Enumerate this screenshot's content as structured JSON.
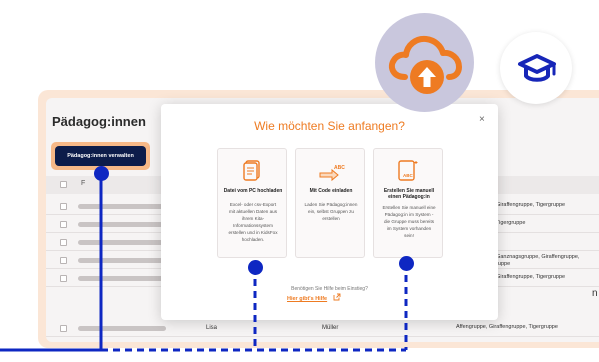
{
  "app": {
    "title": "Pädagog:innen",
    "manage_button": "Pädagog:innen verwalten",
    "header_first_col": "F",
    "side_letter": "n"
  },
  "rows": [
    {
      "first": "",
      "last": "",
      "groups": "Giraffengruppe, Tigergruppe",
      "groups_prefix": ",",
      "lines": 1
    },
    {
      "first": "",
      "last": "",
      "groups": "Tigergruppe",
      "groups_prefix": ",",
      "lines": 1
    },
    {
      "first": "",
      "last": "",
      "groups": "",
      "groups_prefix": "",
      "lines": 1
    },
    {
      "first": "",
      "last": "",
      "groups": "Ganznagsgruppe, Giraffengruppe,",
      "groups_line2": "gruppe",
      "groups_prefix": ",",
      "lines": 2
    },
    {
      "first": "",
      "last": "",
      "groups": "Giraffengruppe, Tigergruppe",
      "groups_prefix": ",",
      "lines": 1
    },
    {
      "first": "Lisa",
      "last": "Müller",
      "groups": "Affengruppe, Giraffengruppe, Tigergruppe",
      "groups_prefix": "",
      "lines": 1
    }
  ],
  "modal": {
    "title": "Wie möchten Sie anfangen?",
    "close_glyph": "×",
    "cards": [
      {
        "icon": "file-upload-icon",
        "title": "Datei vom PC hochladen",
        "text_lines": [
          "Excel- oder csv-Export",
          "mit aktuellen Daten aus",
          "ihrem Kita-",
          "Informationssystem",
          "erstellen und in KidsFox",
          "hochladen."
        ]
      },
      {
        "icon": "code-invite-icon",
        "badge": "ABC",
        "title": "Mit Code einladen",
        "text_lines": [
          "Laden Sie Pädagog:innen",
          "ein, selbst Gruppen zu",
          "erstellen"
        ]
      },
      {
        "icon": "manual-create-icon",
        "badge": "ABC",
        "title_lines": [
          "Erstellen Sie manuell",
          "einen Pädagog:in"
        ],
        "text_lines": [
          "Erstellen Sie manuell eine",
          "Pädagog:in im System -",
          "die Gruppe muss bereits",
          "im System vorhanden",
          "sein!"
        ]
      }
    ],
    "help_question": "Benötigen Sie Hilfe beim Einstieg?",
    "help_link": "Hier gibt's Hilfe"
  },
  "floating_icons": [
    "cloud-upload-icon",
    "graduation-cap-icon"
  ],
  "colors": {
    "accent_orange": "#ee7b22",
    "navy": "#0c1c4a",
    "callout_blue": "#0e27c2",
    "frame_peach": "#fbe6d6",
    "cloud_circle": "#c9c7dd",
    "status_green": "#7fc98c"
  }
}
